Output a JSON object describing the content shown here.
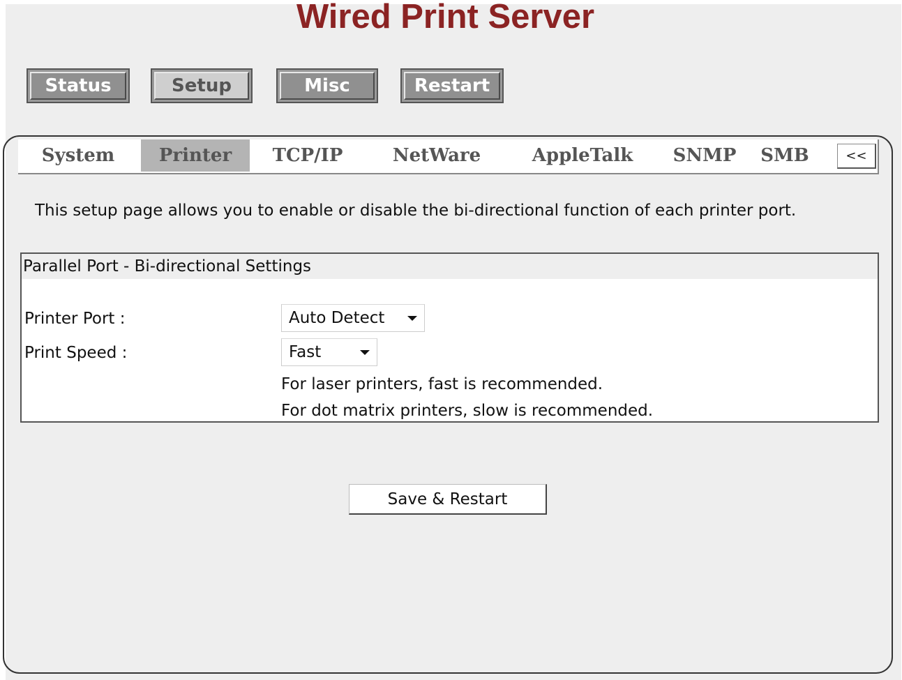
{
  "header": {
    "title": "Wired Print Server"
  },
  "main_nav": {
    "buttons": [
      {
        "label": "Status"
      },
      {
        "label": "Setup"
      },
      {
        "label": "Misc"
      },
      {
        "label": "Restart"
      }
    ],
    "active": "Setup"
  },
  "tabs": {
    "items": [
      {
        "label": "System"
      },
      {
        "label": "Printer"
      },
      {
        "label": "TCP/IP"
      },
      {
        "label": "NetWare"
      },
      {
        "label": "AppleTalk"
      },
      {
        "label": "SNMP"
      },
      {
        "label": "SMB"
      }
    ],
    "active": "Printer",
    "more_label": "<<"
  },
  "description": "This setup page allows you to enable or disable the bi-directional function of each printer port.",
  "settings": {
    "heading": "Parallel Port - Bi-directional Settings",
    "printer_port": {
      "label": "Printer Port :",
      "value": "Auto Detect"
    },
    "print_speed": {
      "label": "Print Speed :",
      "value": "Fast"
    },
    "hints": [
      "For laser printers, fast is recommended.",
      "For dot matrix printers, slow is recommended."
    ]
  },
  "actions": {
    "save_label": "Save & Restart"
  },
  "colors": {
    "title": "#8b2323",
    "page_background": "#eeeeee",
    "active_tab": "#b4b4b4"
  }
}
